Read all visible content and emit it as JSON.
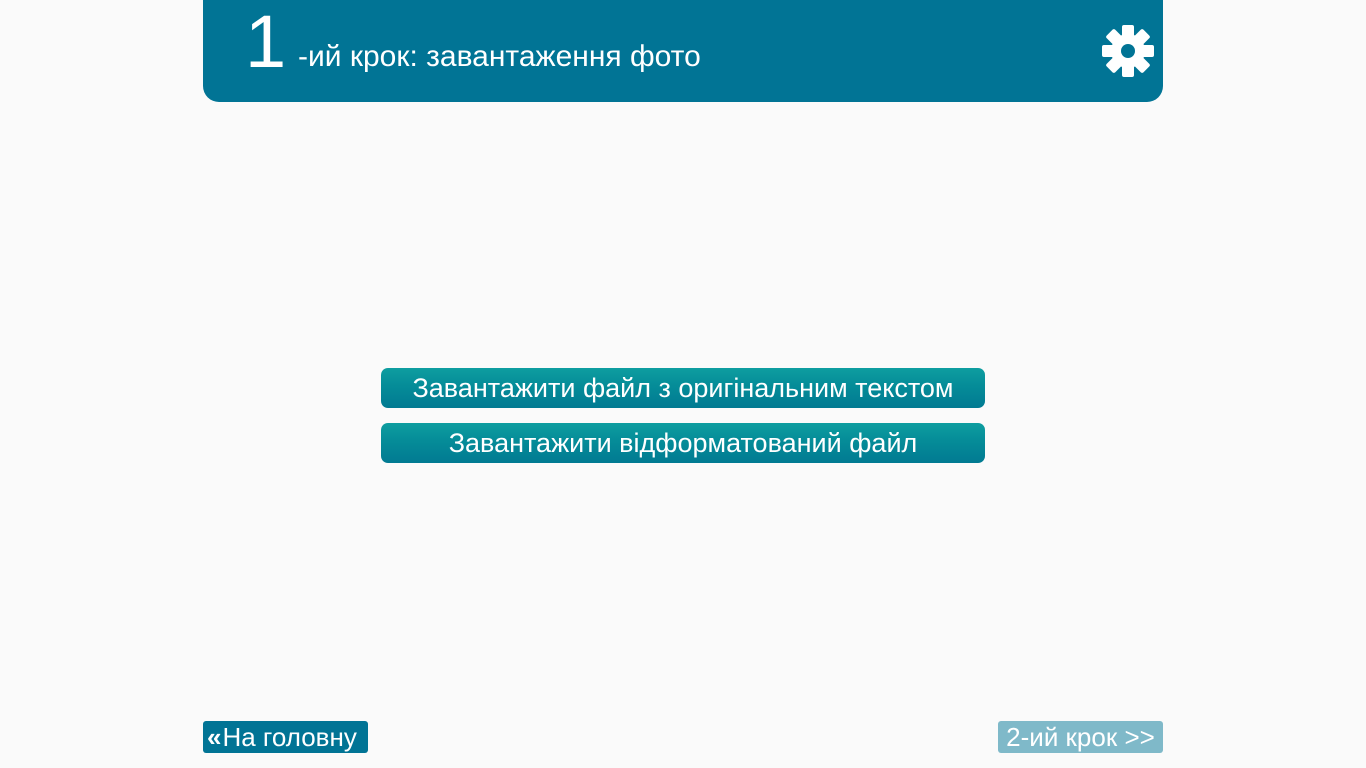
{
  "header": {
    "step_number": "1",
    "step_title": "-ий крок: завантаження фото",
    "settings_icon": "gear-icon",
    "background_color": "#017495"
  },
  "main": {
    "upload_original_label": "Завантажити файл з оригінальним текстом",
    "upload_formatted_label": "Завантажити відформатований файл",
    "button_color": "#058c98"
  },
  "footer": {
    "home_arrow": "«",
    "home_label": "На головну",
    "next_label": "2-ий крок >>",
    "next_color": "#7fb9c9"
  }
}
